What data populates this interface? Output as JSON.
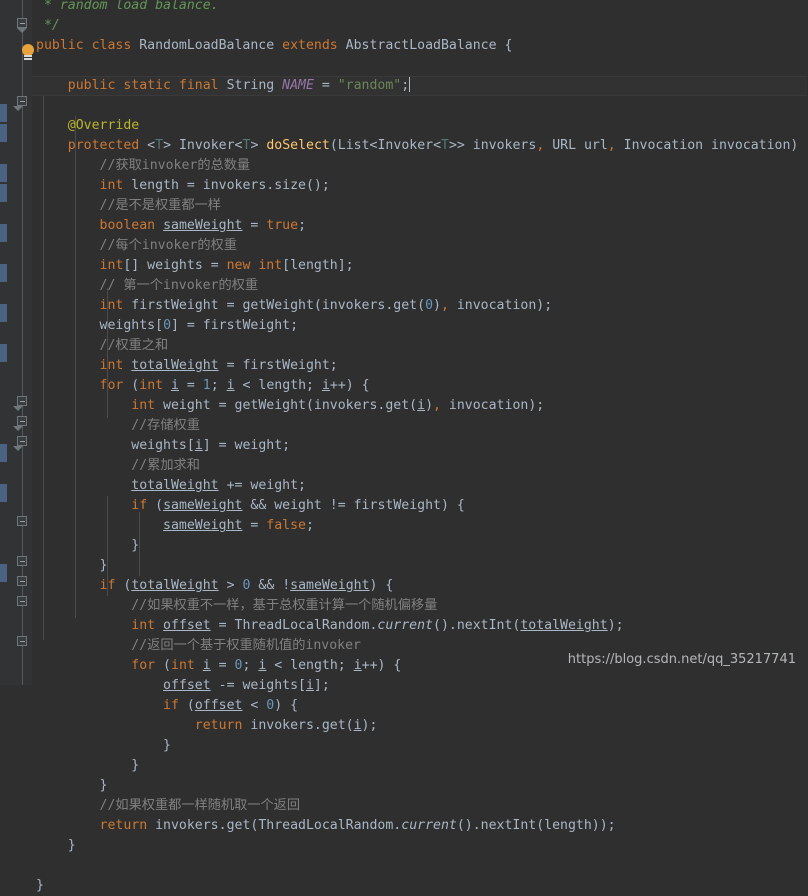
{
  "editor": {
    "theme": "IntelliJ Darcula",
    "language": "Java",
    "colors": {
      "background": "#2F2F2F",
      "gutter": "#313335",
      "caret_line": "#323232",
      "keyword": "#CC7832",
      "comment": "#808080",
      "javadoc": "#629755",
      "string": "#6A8759",
      "number": "#6897BB",
      "annotation": "#BBB529",
      "static_field": "#9876AA",
      "method": "#FFC66D",
      "identifier": "#A9B7C6",
      "vcs_change_bar": "#4A6382"
    },
    "caret_line_number": 2,
    "lines": [
      " * random load balance.",
      " */",
      "public class RandomLoadBalance extends AbstractLoadBalance {",
      "",
      "    public static final String NAME = \"random\";",
      "",
      "    @Override",
      "    protected <T> Invoker<T> doSelect(List<Invoker<T>> invokers, URL url, Invocation invocation) {",
      "        //获取invoker的总数量",
      "        int length = invokers.size();",
      "        //是不是权重都一样",
      "        boolean sameWeight = true;",
      "        //每个invoker的权重",
      "        int[] weights = new int[length];",
      "        // 第一个invoker的权重",
      "        int firstWeight = getWeight(invokers.get(0), invocation);",
      "        weights[0] = firstWeight;",
      "        //权重之和",
      "        int totalWeight = firstWeight;",
      "        for (int i = 1; i < length; i++) {",
      "            int weight = getWeight(invokers.get(i), invocation);",
      "            //存储权重",
      "            weights[i] = weight;",
      "            //累加求和",
      "            totalWeight += weight;",
      "            if (sameWeight && weight != firstWeight) {",
      "                sameWeight = false;",
      "            }",
      "        }",
      "        if (totalWeight > 0 && !sameWeight) {",
      "            //如果权重不一样，基于总权重计算一个随机偏移量",
      "            int offset = ThreadLocalRandom.current().nextInt(totalWeight);",
      "            //返回一个基于权重随机值的invoker",
      "            for (int i = 0; i < length; i++) {",
      "                offset -= weights[i];",
      "                if (offset < 0) {",
      "                    return invokers.get(i);",
      "                }",
      "            }",
      "        }",
      "        //如果权重都一样随机取一个返回",
      "        return invokers.get(ThreadLocalRandom.current().nextInt(length));",
      "    }",
      "",
      "}"
    ]
  },
  "gutter": {
    "bulb_icon": "lightbulb-icon",
    "fold_markers": [
      "fold-end",
      "fold-start",
      "fold-end",
      "fold-start",
      "fold-start",
      "fold-end",
      "fold-end",
      "fold-end",
      "fold-end"
    ],
    "vcs_change_bars": 11
  },
  "watermark": {
    "text": "https://blog.csdn.net/qq_35217741"
  }
}
